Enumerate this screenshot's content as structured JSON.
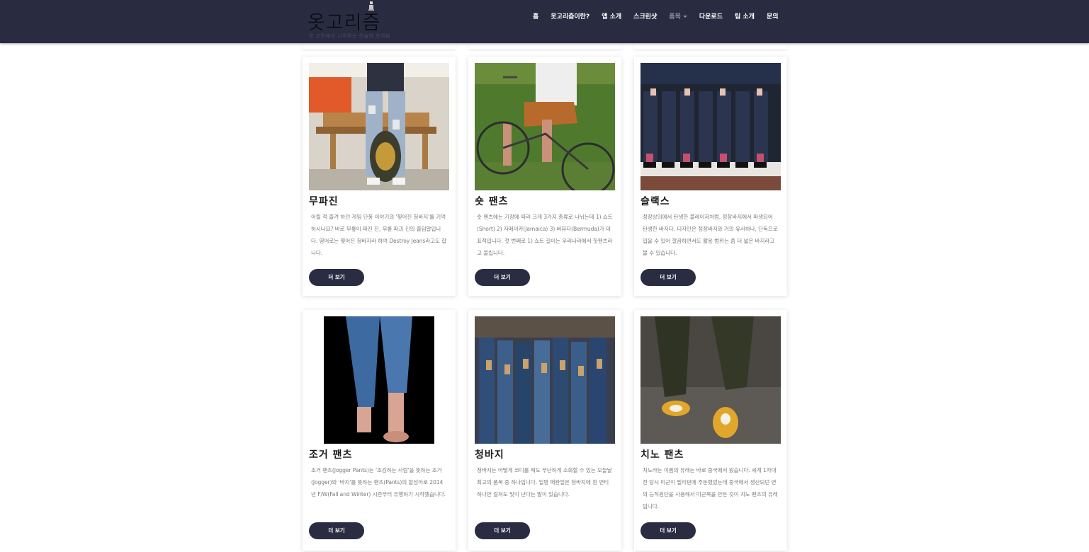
{
  "header": {
    "logo_title": "옷고리즘",
    "logo_subtitle": "옷 고민에서 시작하는 오늘의 옷차림",
    "nav": [
      {
        "label": "홈"
      },
      {
        "label": "옷고리즘이란?"
      },
      {
        "label": "앱 소개"
      },
      {
        "label": "스크린샷"
      },
      {
        "label": "품목",
        "muted": true,
        "dropdown": true
      },
      {
        "label": "다운로드"
      },
      {
        "label": "팀 소개"
      },
      {
        "label": "문의"
      }
    ]
  },
  "cards": [
    {
      "title": "무파진",
      "description": "어릴 적 즐겨 하던 게임 단풍 이야기의 '찢어진 청바지'를 기억하시나요? 바로 무릎이 파진 진, 무릎 파괴 진의 줄임말입니다. 영어로는 찢어진 청바지라 하여 Destroy Jeans라고도 합니다.",
      "button": "더 보기",
      "image": "ripped-jeans-photo"
    },
    {
      "title": "숏 팬츠",
      "description": "숏 팬츠에는 기장에 따라 크게 3가지 종류로 나뉘는데 1) 쇼트(Short) 2) 자메이카(Jamaica) 3) 버뮤다(Bermuda)가 대표적입니다. 첫 번째로 1) 쇼트 길이는 우리나라에서 핫팬츠라고 불립니다.",
      "button": "더 보기",
      "image": "short-pants-bicycle-photo"
    },
    {
      "title": "슬랙스",
      "description": "정장상의에서 탄생한 블레이저처럼, 정장바지에서 파생되어 탄생한 바지다. 디자인은 정장바지와 거의 유사하나, 단독으로 입을 수 있어 깔끔하면서도 활용 범위는 좀 더 넓은 바지라고 볼 수 있습니다.",
      "button": "더 보기",
      "image": "slacks-photo"
    },
    {
      "title": "조거 팬츠",
      "description": "조거 팬츠(Jogger Pants)는 '조깅하는 사람'을 뜻하는 조거(Jogger)와 '바지'를 뜻하는 팬츠(Pants)의 합성어로 2014년 F/W(Fall and Winter) 시즌부터 유행하기 시작했습니다.",
      "button": "더 보기",
      "image": "jogger-pants-photo"
    },
    {
      "title": "청바지",
      "description": "청바지는 어떻게 코디를 해도 무난하게 소화할 수 있는 오늘날 최고의 품목 중 하나입니다. 일명 패완얼은 청바지에 흰 면티 하나만 걸쳐도 빛이 난다는 말이 있습니다.",
      "button": "더 보기",
      "image": "jeans-rack-photo"
    },
    {
      "title": "치노 팬츠",
      "description": "치노라는 이름의 유래는 바로 중국에서 왔습니다. 세계 1차대전 당시 미군이 필리핀에 주둔했었는데 중국에서 생산되던 면의 능직원단을 사용해서 미군복을 만든 것이 치노 팬츠의 유래입니다.",
      "button": "더 보기",
      "image": "chino-pants-photo"
    }
  ],
  "colors": {
    "navbar_bg": "#292c40",
    "button_bg": "#2a2d42",
    "text_muted": "#7b7b7b"
  }
}
